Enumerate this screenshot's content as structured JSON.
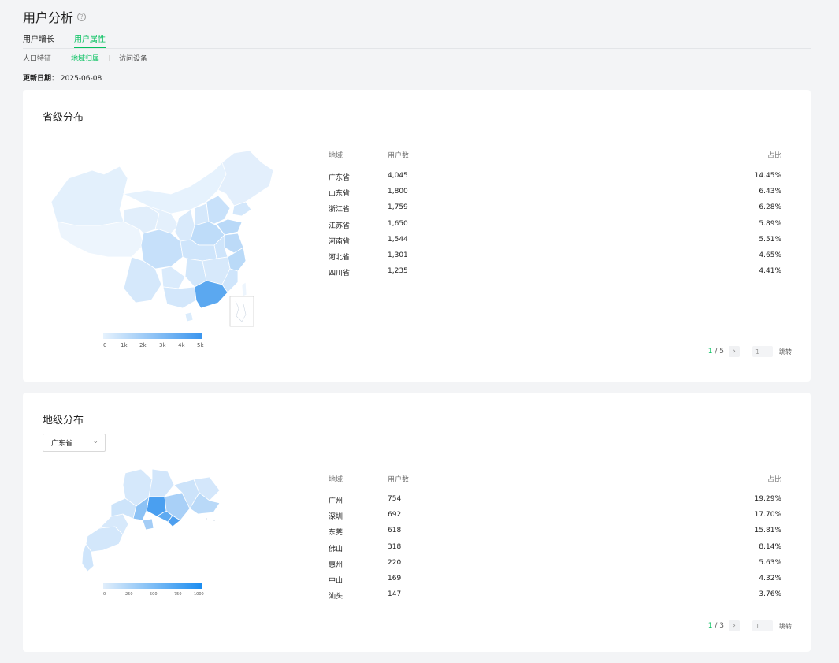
{
  "header": {
    "title": "用户分析",
    "help_icon": "?"
  },
  "tabs": [
    {
      "label": "用户增长",
      "active": false
    },
    {
      "label": "用户属性",
      "active": true
    }
  ],
  "subtabs": [
    {
      "label": "人口特征",
      "active": false
    },
    {
      "label": "地域归属",
      "active": true
    },
    {
      "label": "访问设备",
      "active": false
    }
  ],
  "update": {
    "label": "更新日期：",
    "date": "2025-06-08"
  },
  "colors": {
    "accent": "#07c160",
    "map_low": "#e6f2fd",
    "map_high": "#3a95ee"
  },
  "province": {
    "title": "省级分布",
    "columns": {
      "region": "地域",
      "users": "用户数",
      "pct": "占比"
    },
    "rows": [
      {
        "region": "广东省",
        "users": "4,045",
        "pct": "14.45%"
      },
      {
        "region": "山东省",
        "users": "1,800",
        "pct": "6.43%"
      },
      {
        "region": "浙江省",
        "users": "1,759",
        "pct": "6.28%"
      },
      {
        "region": "江苏省",
        "users": "1,650",
        "pct": "5.89%"
      },
      {
        "region": "河南省",
        "users": "1,544",
        "pct": "5.51%"
      },
      {
        "region": "河北省",
        "users": "1,301",
        "pct": "4.65%"
      },
      {
        "region": "四川省",
        "users": "1,235",
        "pct": "4.41%"
      }
    ],
    "legend_ticks": [
      "0",
      "1k",
      "2k",
      "3k",
      "4k",
      "5k"
    ],
    "pager": {
      "current": "1",
      "sep": " / ",
      "total": "5",
      "next": "›",
      "input": "1",
      "jump": "跳转"
    }
  },
  "city": {
    "title": "地级分布",
    "select_value": "广东省",
    "columns": {
      "region": "地域",
      "users": "用户数",
      "pct": "占比"
    },
    "rows": [
      {
        "region": "广州",
        "users": "754",
        "pct": "19.29%"
      },
      {
        "region": "深圳",
        "users": "692",
        "pct": "17.70%"
      },
      {
        "region": "东莞",
        "users": "618",
        "pct": "15.81%"
      },
      {
        "region": "佛山",
        "users": "318",
        "pct": "8.14%"
      },
      {
        "region": "惠州",
        "users": "220",
        "pct": "5.63%"
      },
      {
        "region": "中山",
        "users": "169",
        "pct": "4.32%"
      },
      {
        "region": "汕头",
        "users": "147",
        "pct": "3.76%"
      }
    ],
    "legend_ticks": [
      "0",
      "250",
      "500",
      "750",
      "1000"
    ],
    "pager": {
      "current": "1",
      "sep": " / ",
      "total": "3",
      "next": "›",
      "input": "1",
      "jump": "跳转"
    }
  }
}
